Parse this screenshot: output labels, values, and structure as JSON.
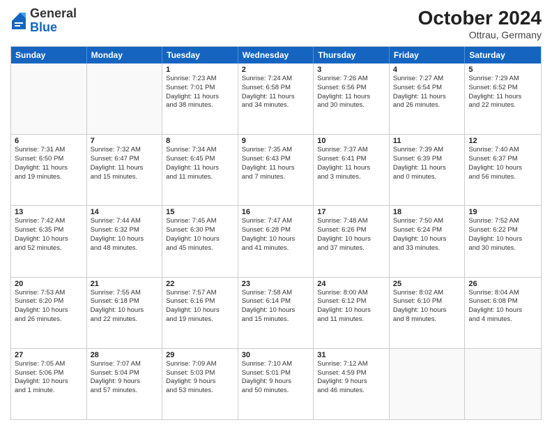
{
  "header": {
    "logo": {
      "general": "General",
      "blue": "Blue"
    },
    "title": "October 2024",
    "location": "Ottrau, Germany"
  },
  "days_of_week": [
    "Sunday",
    "Monday",
    "Tuesday",
    "Wednesday",
    "Thursday",
    "Friday",
    "Saturday"
  ],
  "weeks": [
    [
      {
        "day": "",
        "empty": true
      },
      {
        "day": "",
        "empty": true
      },
      {
        "day": "1",
        "lines": [
          "Sunrise: 7:23 AM",
          "Sunset: 7:01 PM",
          "Daylight: 11 hours",
          "and 38 minutes."
        ]
      },
      {
        "day": "2",
        "lines": [
          "Sunrise: 7:24 AM",
          "Sunset: 6:58 PM",
          "Daylight: 11 hours",
          "and 34 minutes."
        ]
      },
      {
        "day": "3",
        "lines": [
          "Sunrise: 7:26 AM",
          "Sunset: 6:56 PM",
          "Daylight: 11 hours",
          "and 30 minutes."
        ]
      },
      {
        "day": "4",
        "lines": [
          "Sunrise: 7:27 AM",
          "Sunset: 6:54 PM",
          "Daylight: 11 hours",
          "and 26 minutes."
        ]
      },
      {
        "day": "5",
        "lines": [
          "Sunrise: 7:29 AM",
          "Sunset: 6:52 PM",
          "Daylight: 11 hours",
          "and 22 minutes."
        ]
      }
    ],
    [
      {
        "day": "6",
        "lines": [
          "Sunrise: 7:31 AM",
          "Sunset: 6:50 PM",
          "Daylight: 11 hours",
          "and 19 minutes."
        ]
      },
      {
        "day": "7",
        "lines": [
          "Sunrise: 7:32 AM",
          "Sunset: 6:47 PM",
          "Daylight: 11 hours",
          "and 15 minutes."
        ]
      },
      {
        "day": "8",
        "lines": [
          "Sunrise: 7:34 AM",
          "Sunset: 6:45 PM",
          "Daylight: 11 hours",
          "and 11 minutes."
        ]
      },
      {
        "day": "9",
        "lines": [
          "Sunrise: 7:35 AM",
          "Sunset: 6:43 PM",
          "Daylight: 11 hours",
          "and 7 minutes."
        ]
      },
      {
        "day": "10",
        "lines": [
          "Sunrise: 7:37 AM",
          "Sunset: 6:41 PM",
          "Daylight: 11 hours",
          "and 3 minutes."
        ]
      },
      {
        "day": "11",
        "lines": [
          "Sunrise: 7:39 AM",
          "Sunset: 6:39 PM",
          "Daylight: 11 hours",
          "and 0 minutes."
        ]
      },
      {
        "day": "12",
        "lines": [
          "Sunrise: 7:40 AM",
          "Sunset: 6:37 PM",
          "Daylight: 10 hours",
          "and 56 minutes."
        ]
      }
    ],
    [
      {
        "day": "13",
        "lines": [
          "Sunrise: 7:42 AM",
          "Sunset: 6:35 PM",
          "Daylight: 10 hours",
          "and 52 minutes."
        ]
      },
      {
        "day": "14",
        "lines": [
          "Sunrise: 7:44 AM",
          "Sunset: 6:32 PM",
          "Daylight: 10 hours",
          "and 48 minutes."
        ]
      },
      {
        "day": "15",
        "lines": [
          "Sunrise: 7:45 AM",
          "Sunset: 6:30 PM",
          "Daylight: 10 hours",
          "and 45 minutes."
        ]
      },
      {
        "day": "16",
        "lines": [
          "Sunrise: 7:47 AM",
          "Sunset: 6:28 PM",
          "Daylight: 10 hours",
          "and 41 minutes."
        ]
      },
      {
        "day": "17",
        "lines": [
          "Sunrise: 7:48 AM",
          "Sunset: 6:26 PM",
          "Daylight: 10 hours",
          "and 37 minutes."
        ]
      },
      {
        "day": "18",
        "lines": [
          "Sunrise: 7:50 AM",
          "Sunset: 6:24 PM",
          "Daylight: 10 hours",
          "and 33 minutes."
        ]
      },
      {
        "day": "19",
        "lines": [
          "Sunrise: 7:52 AM",
          "Sunset: 6:22 PM",
          "Daylight: 10 hours",
          "and 30 minutes."
        ]
      }
    ],
    [
      {
        "day": "20",
        "lines": [
          "Sunrise: 7:53 AM",
          "Sunset: 6:20 PM",
          "Daylight: 10 hours",
          "and 26 minutes."
        ]
      },
      {
        "day": "21",
        "lines": [
          "Sunrise: 7:55 AM",
          "Sunset: 6:18 PM",
          "Daylight: 10 hours",
          "and 22 minutes."
        ]
      },
      {
        "day": "22",
        "lines": [
          "Sunrise: 7:57 AM",
          "Sunset: 6:16 PM",
          "Daylight: 10 hours",
          "and 19 minutes."
        ]
      },
      {
        "day": "23",
        "lines": [
          "Sunrise: 7:58 AM",
          "Sunset: 6:14 PM",
          "Daylight: 10 hours",
          "and 15 minutes."
        ]
      },
      {
        "day": "24",
        "lines": [
          "Sunrise: 8:00 AM",
          "Sunset: 6:12 PM",
          "Daylight: 10 hours",
          "and 11 minutes."
        ]
      },
      {
        "day": "25",
        "lines": [
          "Sunrise: 8:02 AM",
          "Sunset: 6:10 PM",
          "Daylight: 10 hours",
          "and 8 minutes."
        ]
      },
      {
        "day": "26",
        "lines": [
          "Sunrise: 8:04 AM",
          "Sunset: 6:08 PM",
          "Daylight: 10 hours",
          "and 4 minutes."
        ]
      }
    ],
    [
      {
        "day": "27",
        "lines": [
          "Sunrise: 7:05 AM",
          "Sunset: 5:06 PM",
          "Daylight: 10 hours",
          "and 1 minute."
        ]
      },
      {
        "day": "28",
        "lines": [
          "Sunrise: 7:07 AM",
          "Sunset: 5:04 PM",
          "Daylight: 9 hours",
          "and 57 minutes."
        ]
      },
      {
        "day": "29",
        "lines": [
          "Sunrise: 7:09 AM",
          "Sunset: 5:03 PM",
          "Daylight: 9 hours",
          "and 53 minutes."
        ]
      },
      {
        "day": "30",
        "lines": [
          "Sunrise: 7:10 AM",
          "Sunset: 5:01 PM",
          "Daylight: 9 hours",
          "and 50 minutes."
        ]
      },
      {
        "day": "31",
        "lines": [
          "Sunrise: 7:12 AM",
          "Sunset: 4:59 PM",
          "Daylight: 9 hours",
          "and 46 minutes."
        ]
      },
      {
        "day": "",
        "empty": true
      },
      {
        "day": "",
        "empty": true
      }
    ]
  ]
}
